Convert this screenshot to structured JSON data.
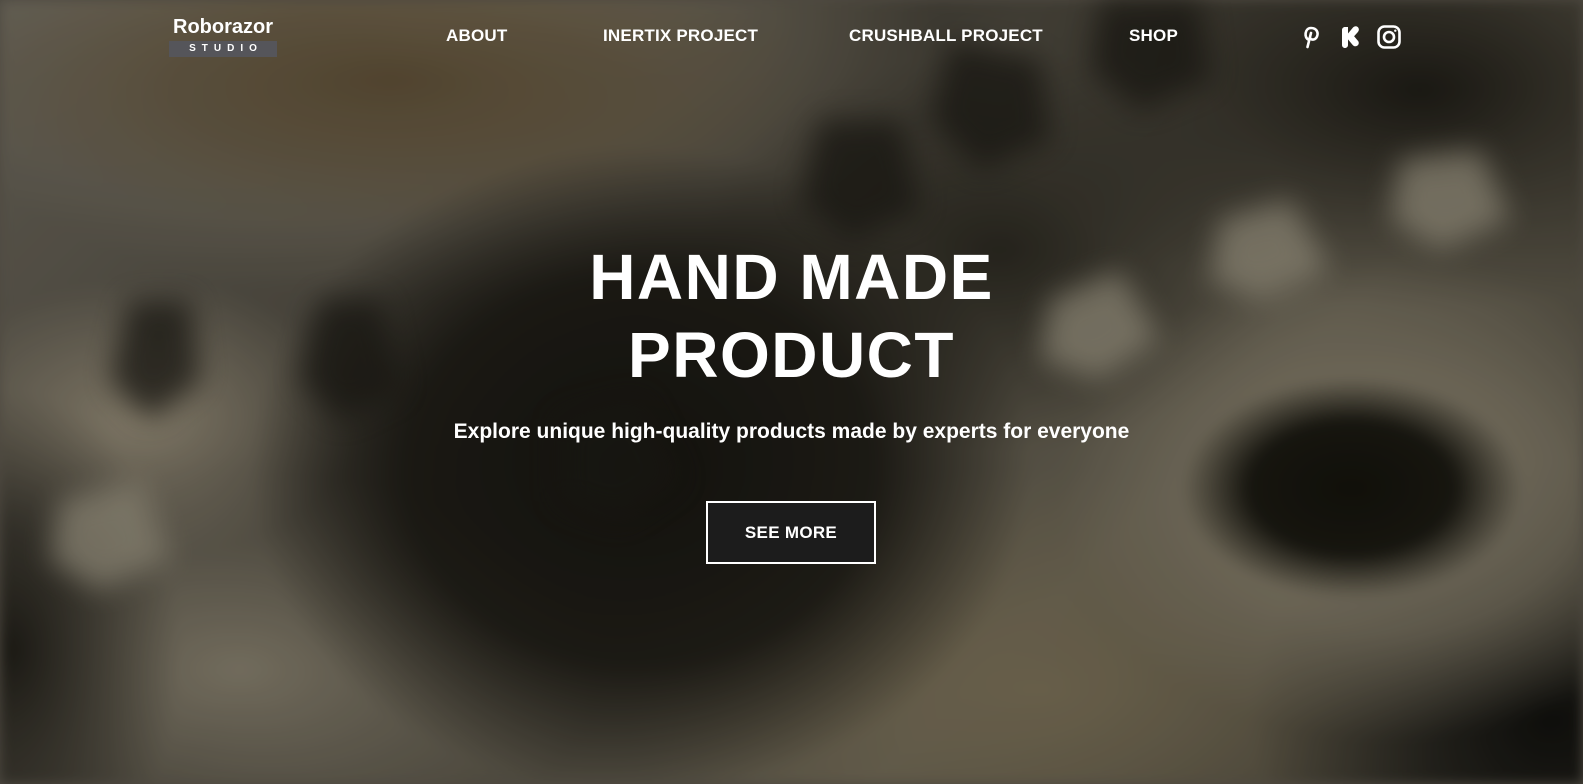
{
  "brand": {
    "name": "Roborazor",
    "subtitle": "STUDIO"
  },
  "nav": {
    "items": [
      {
        "label": "ABOUT"
      },
      {
        "label": "INERTIX PROJECT"
      },
      {
        "label": "CRUSHBALL PROJECT"
      },
      {
        "label": "SHOP"
      }
    ]
  },
  "social": [
    {
      "icon": "pinterest-icon"
    },
    {
      "icon": "kickstarter-icon"
    },
    {
      "icon": "instagram-icon"
    }
  ],
  "hero": {
    "title_line1": "HAND MADE",
    "title_line2": "PRODUCT",
    "subtitle": "Explore unique high-quality products made by experts for everyone",
    "cta_label": "SEE MORE"
  },
  "colors": {
    "text": "#ffffff",
    "button_bg": "#1c1c1c",
    "button_border": "#ffffff",
    "logo_sub_bg": "#55555a"
  }
}
